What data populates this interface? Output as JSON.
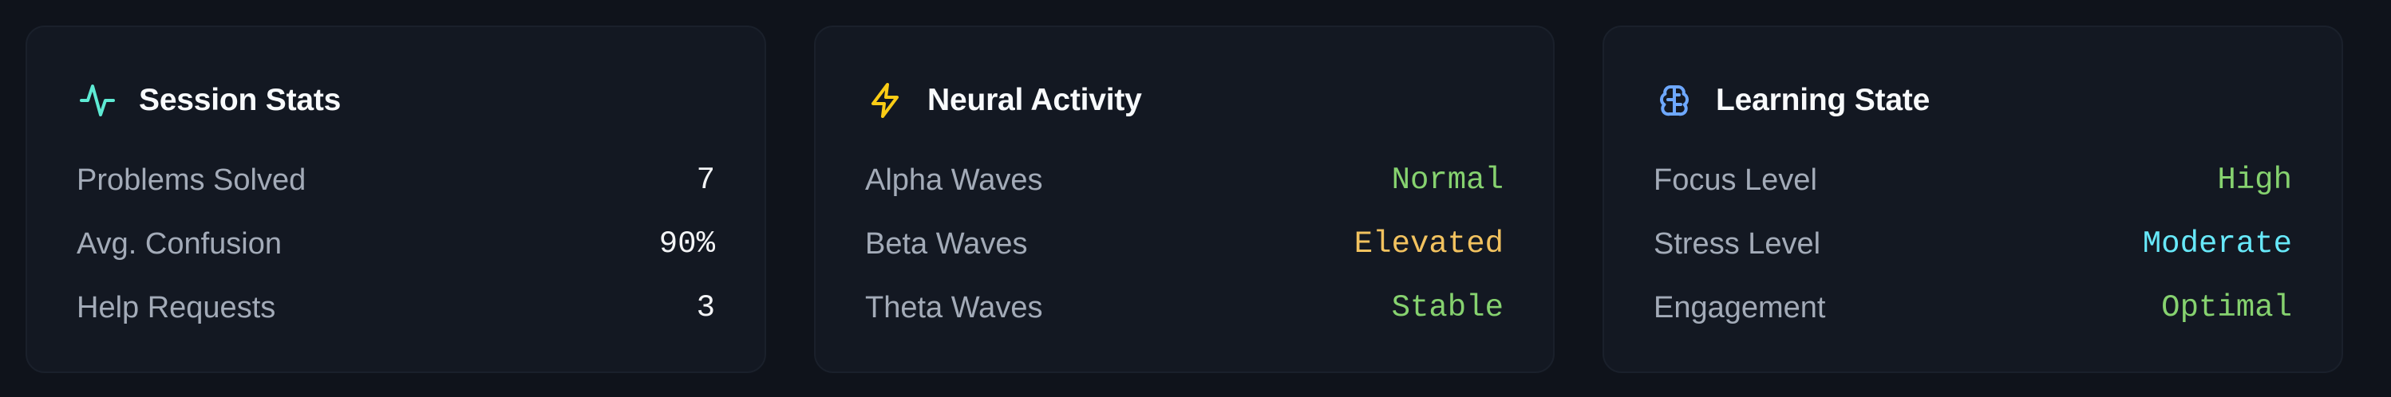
{
  "cards": [
    {
      "title": "Session Stats",
      "icon": "activity-icon",
      "icon_color": "#5eead4",
      "rows": [
        {
          "label": "Problems Solved",
          "value": "7",
          "color": "#f3f4f6"
        },
        {
          "label": "Avg. Confusion",
          "value": "90%",
          "color": "#f3f4f6"
        },
        {
          "label": "Help Requests",
          "value": "3",
          "color": "#f3f4f6"
        }
      ]
    },
    {
      "title": "Neural Activity",
      "icon": "lightning-icon",
      "icon_color": "#facc15",
      "rows": [
        {
          "label": "Alpha Waves",
          "value": "Normal",
          "color": "#86d26f"
        },
        {
          "label": "Beta Waves",
          "value": "Elevated",
          "color": "#f2c25f"
        },
        {
          "label": "Theta Waves",
          "value": "Stable",
          "color": "#86d26f"
        }
      ]
    },
    {
      "title": "Learning State",
      "icon": "brain-icon",
      "icon_color": "#6ea8ff",
      "rows": [
        {
          "label": "Focus Level",
          "value": "High",
          "color": "#86d26f"
        },
        {
          "label": "Stress Level",
          "value": "Moderate",
          "color": "#67e8f9"
        },
        {
          "label": "Engagement",
          "value": "Optimal",
          "color": "#86d26f"
        }
      ]
    }
  ]
}
